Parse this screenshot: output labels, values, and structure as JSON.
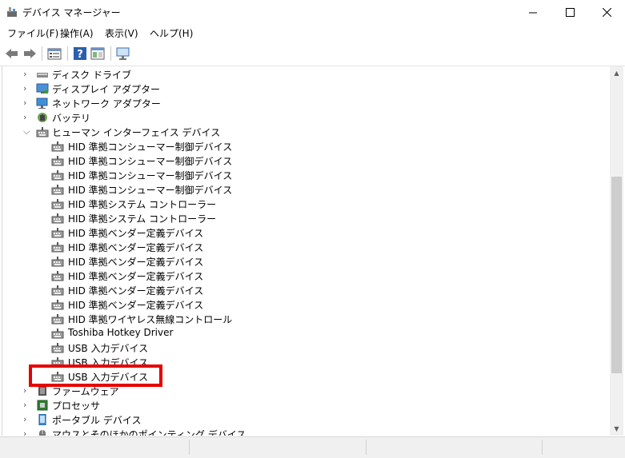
{
  "window": {
    "title": "デバイス マネージャー",
    "minimize_glyph": "—",
    "maximize_glyph": "☐",
    "close_glyph": "✕"
  },
  "menu": [
    {
      "label": "ファイル(F)"
    },
    {
      "label": "操作(A)"
    },
    {
      "label": "表示(V)"
    },
    {
      "label": "ヘルプ(H)"
    }
  ],
  "tree": {
    "categories_before": [
      {
        "label": "ディスク ドライブ",
        "icon": "disk-drive-icon"
      },
      {
        "label": "ディスプレイ アダプター",
        "icon": "display-adapter-icon"
      },
      {
        "label": "ネットワーク アダプター",
        "icon": "network-adapter-icon"
      },
      {
        "label": "バッテリ",
        "icon": "battery-icon"
      }
    ],
    "expanded_category": {
      "label": "ヒューマン インターフェイス デバイス",
      "icon": "hid-icon"
    },
    "children": [
      "HID 準拠コンシューマー制御デバイス",
      "HID 準拠コンシューマー制御デバイス",
      "HID 準拠コンシューマー制御デバイス",
      "HID 準拠コンシューマー制御デバイス",
      "HID 準拠システム コントローラー",
      "HID 準拠システム コントローラー",
      "HID 準拠ベンダー定義デバイス",
      "HID 準拠ベンダー定義デバイス",
      "HID 準拠ベンダー定義デバイス",
      "HID 準拠ベンダー定義デバイス",
      "HID 準拠ベンダー定義デバイス",
      "HID 準拠ベンダー定義デバイス",
      "HID 準拠ワイヤレス無線コントロール",
      "Toshiba Hotkey Driver",
      "USB 入力デバイス",
      "USB 入力デバイス",
      "USB 入力デバイス"
    ],
    "categories_after": [
      {
        "label": "ファームウェア",
        "icon": "firmware-icon"
      },
      {
        "label": "プロセッサ",
        "icon": "processor-icon"
      },
      {
        "label": "ポータブル デバイス",
        "icon": "portable-device-icon"
      },
      {
        "label": "マウスとそのほかのポインティング デバイス",
        "icon": "mouse-icon"
      }
    ],
    "collapsed_glyph": "›",
    "expanded_glyph": "⌵"
  },
  "colors": {
    "highlight": "#e60000"
  }
}
